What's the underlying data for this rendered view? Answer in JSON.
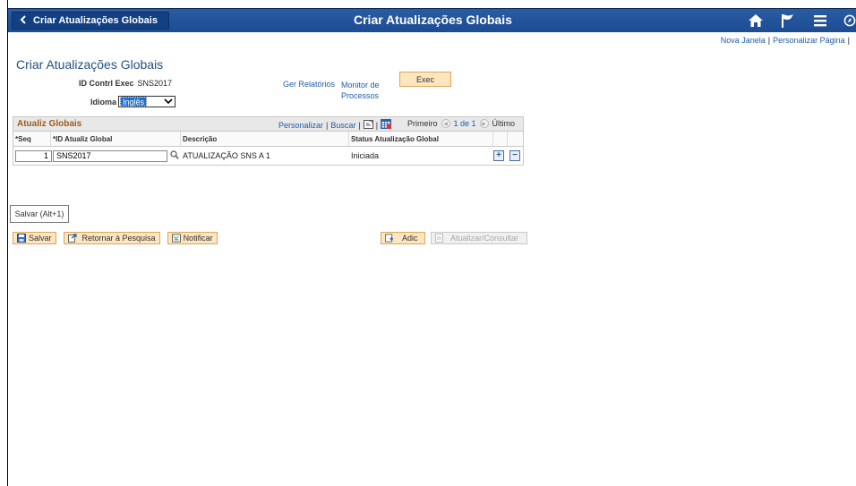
{
  "banner": {
    "back_label": "Criar Atualizações Globais",
    "title": "Criar Atualizações Globais",
    "icons": [
      "home-icon",
      "flag-icon",
      "menu-icon",
      "navbar-icon"
    ]
  },
  "toplinks": {
    "new_window": "Nova Janela",
    "personalize_page": "Personalizar Página"
  },
  "page": {
    "title": "Criar Atualizações Globais",
    "run_control_label": "ID Contrl Exec",
    "run_control_value": "SNS2017",
    "language_label": "Idioma",
    "language_value": "Inglês",
    "report_manager": "Ger Relatórios",
    "process_monitor": "Monitor de Processos",
    "run_button": "Exec"
  },
  "grid": {
    "title": "Atualiz Globais",
    "personalize": "Personalizar",
    "find": "Buscar",
    "first": "Primeiro",
    "range": "1 de 1",
    "last": "Último",
    "columns": [
      "*Seq",
      "*ID Atualiz Global",
      "Descrição",
      "Status Atualização Global"
    ],
    "rows": [
      {
        "seq": "1",
        "id": "SNS2017",
        "desc": "ATUALIZAÇÃO SNS A 1",
        "status": "Iniciada"
      }
    ]
  },
  "tooltip": "Salvar (Alt+1)",
  "buttons": {
    "save": "Salvar",
    "return": "Retornar à Pesquisa",
    "notify": "Notificar",
    "add": "Adic",
    "update": "Atualizar/Consultar"
  },
  "colors": {
    "banner": "#1c4c92",
    "link": "#1f5da7",
    "button_bg": "#fde5be",
    "grid_title": "#a05a1f"
  }
}
